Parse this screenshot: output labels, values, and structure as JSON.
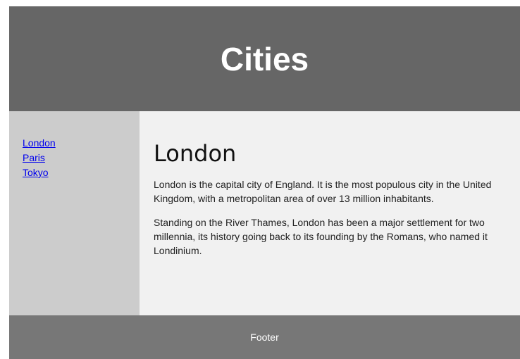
{
  "header": {
    "title": "Cities"
  },
  "nav": {
    "items": [
      {
        "label": "London"
      },
      {
        "label": "Paris"
      },
      {
        "label": "Tokyo"
      }
    ]
  },
  "article": {
    "heading": "London",
    "paragraphs": [
      "London is the capital city of England. It is the most populous city in the United Kingdom, with a metropolitan area of over 13 million inhabitants.",
      "Standing on the River Thames, London has been a major settlement for two millennia, its history going back to its founding by the Romans, who named it Londinium."
    ]
  },
  "footer": {
    "text": "Footer"
  },
  "colors": {
    "header_bg": "#666666",
    "nav_bg": "#cccccc",
    "article_bg": "#f1f1f1",
    "footer_bg": "#777777",
    "link": "#0000ee"
  }
}
